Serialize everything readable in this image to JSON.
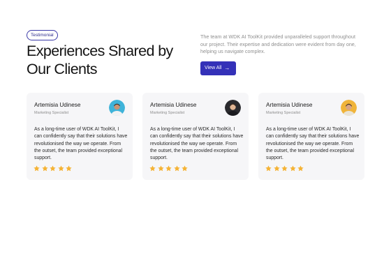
{
  "section": {
    "badge": "Testimonial",
    "headline_line1": "Experiences Shared by",
    "headline_line2": "Our Clients",
    "intro": "The team at WDK AI ToolKit provided unparalleled support throughout our project. Their expertise and dedication were evident from day one, helping us navigate complex.",
    "view_all_label": "View All",
    "view_all_icon": "arrow-right-icon"
  },
  "colors": {
    "accent": "#3431b8",
    "star": "#f5b335",
    "card_bg": "#f6f6f8"
  },
  "testimonials": [
    {
      "name": "Artemisia Udinese",
      "role": "Marketing Specialist",
      "quote": "As a long-time user of WDK AI ToolKit, I can confidently say that their solutions have revolutionised the way we operate. From the outset, the team provided exceptional support.",
      "rating": 5,
      "avatar_bg": "#3fb3d9"
    },
    {
      "name": "Artemisia Udinese",
      "role": "Marketing Specialist",
      "quote": "As a long-time user of WDK AI ToolKit, I can confidently say that their solutions have revolutionised the way we operate. From the outset, the team provided exceptional support.",
      "rating": 5,
      "avatar_bg": "#2a2a2e"
    },
    {
      "name": "Artemisia Udinese",
      "role": "Marketing Specialist",
      "quote": "As a long-time user of WDK AI ToolKit, I can confidently say that their solutions have revolutionised the way we operate. From the outset, the team provided exceptional support.",
      "rating": 5,
      "avatar_bg": "#f0b43a"
    }
  ]
}
